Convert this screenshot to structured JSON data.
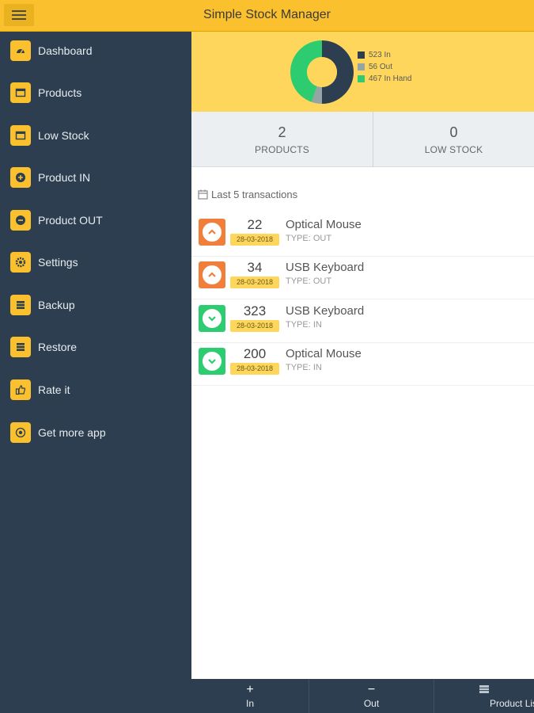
{
  "header": {
    "title": "Simple Stock Manager"
  },
  "sidebar": {
    "items": [
      {
        "label": "Dashboard"
      },
      {
        "label": "Products"
      },
      {
        "label": "Low Stock"
      },
      {
        "label": "Product IN"
      },
      {
        "label": "Product OUT"
      },
      {
        "label": "Settings"
      },
      {
        "label": "Backup"
      },
      {
        "label": "Restore"
      },
      {
        "label": "Rate it"
      },
      {
        "label": "Get more app"
      }
    ]
  },
  "chart_data": {
    "type": "pie",
    "categories": [
      "523 In",
      "56 Out",
      "467 In Hand"
    ],
    "values": [
      523,
      56,
      467
    ],
    "colors": [
      "#2c3e50",
      "#95a5a6",
      "#2ecc71"
    ],
    "legend": [
      "523 In",
      "56 Out",
      "467 In Hand"
    ],
    "donut": true
  },
  "stats": {
    "products": {
      "value": "2",
      "label": "PRODUCTS"
    },
    "low_stock": {
      "value": "0",
      "label": "LOW STOCK"
    }
  },
  "transactions": {
    "heading": "Last 5 transactions",
    "items": [
      {
        "qty": "22",
        "date": "28-03-2018",
        "name": "Optical Mouse",
        "type": "TYPE: OUT",
        "direction": "out"
      },
      {
        "qty": "34",
        "date": "28-03-2018",
        "name": "USB Keyboard",
        "type": "TYPE: OUT",
        "direction": "out"
      },
      {
        "qty": "323",
        "date": "28-03-2018",
        "name": "USB Keyboard",
        "type": "TYPE: IN",
        "direction": "in"
      },
      {
        "qty": "200",
        "date": "28-03-2018",
        "name": "Optical Mouse",
        "type": "TYPE: IN",
        "direction": "in"
      }
    ]
  },
  "bottom_bar": {
    "in_label": "In",
    "out_label": "Out",
    "product_list_label": "Product List"
  },
  "colors": {
    "accent": "#fbc02d",
    "sidebar": "#2c3e50",
    "out": "#f07f3c",
    "in": "#2ecc71"
  }
}
